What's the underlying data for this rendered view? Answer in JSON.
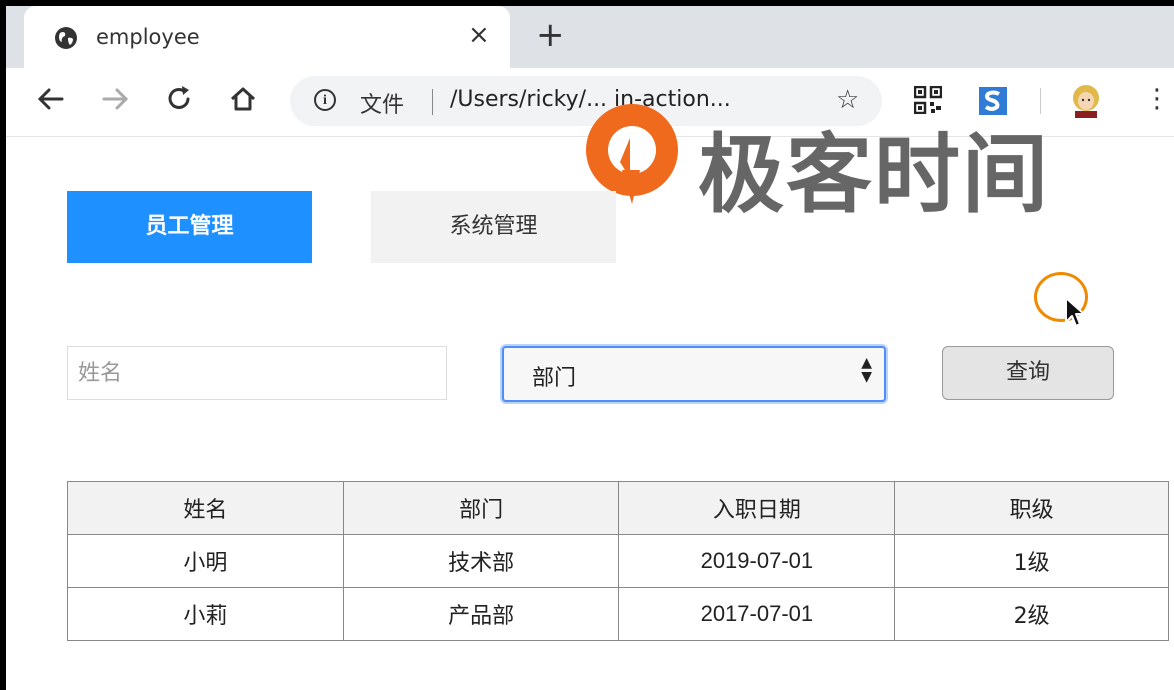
{
  "browser": {
    "tab_title": "employee",
    "close_glyph": "×",
    "new_tab_glyph": "+",
    "address_scheme_label": "文件",
    "address_url": "/Users/ricky/... in-action...",
    "icons": [
      "globe-icon",
      "back-icon",
      "forward-icon",
      "reload-icon",
      "home-icon",
      "info-icon",
      "star-icon",
      "qr-code-icon",
      "s-extension-icon",
      "profile-avatar-icon",
      "menu-icon"
    ]
  },
  "watermark": {
    "text": "极客时间",
    "logo_color": "#f06a1e"
  },
  "nav": {
    "tabs": [
      {
        "label": "员工管理",
        "active": true
      },
      {
        "label": "系统管理",
        "active": false
      }
    ],
    "active_color": "#1e90ff"
  },
  "filters": {
    "name_placeholder": "姓名",
    "department_selected": "部门",
    "query_label": "查询"
  },
  "table": {
    "headers": [
      "姓名",
      "部门",
      "入职日期",
      "职级"
    ],
    "rows": [
      [
        "小明",
        "技术部",
        "2019-07-01",
        "1级"
      ],
      [
        "小莉",
        "产品部",
        "2017-07-01",
        "2级"
      ]
    ]
  }
}
